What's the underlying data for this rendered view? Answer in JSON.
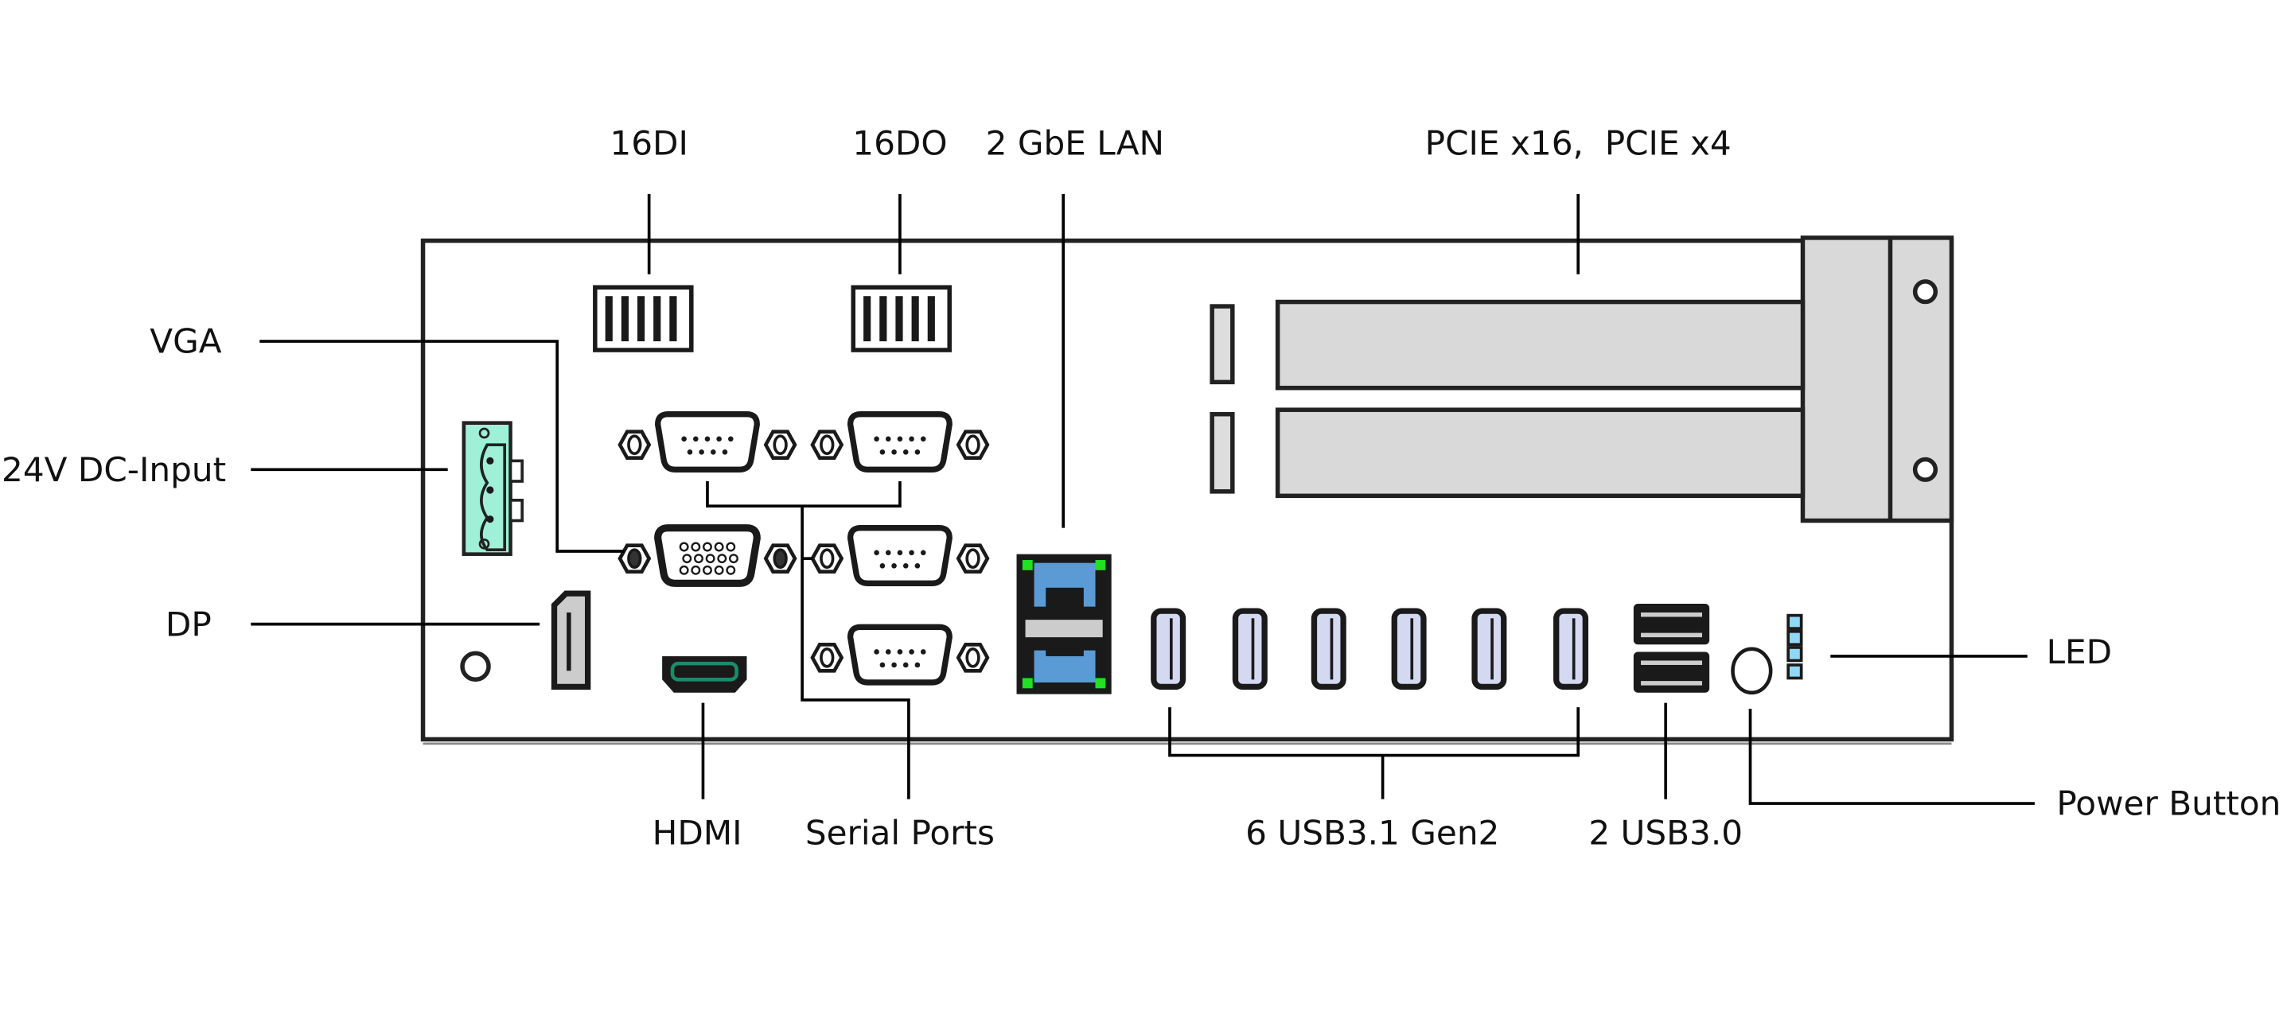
{
  "labels": {
    "di": "16DI",
    "do": "16DO",
    "lan": "2 GbE LAN",
    "pcie": "PCIE x16,  PCIE x4",
    "vga": "VGA",
    "dc": "24V DC-Input",
    "dp": "DP",
    "hdmi": "HDMI",
    "serial": "Serial Ports",
    "usb31": "6 USB3.1 Gen2",
    "usb30": "2 USB3.0",
    "led": "LED",
    "power": "Power Button"
  },
  "colors": {
    "dc_terminal": "#9ff0d6",
    "lan_port": "#5b9bd5",
    "lan_led": "#22e022",
    "hdmi_accent": "#1e8a6a",
    "usb_insert": "#d4d8f0",
    "led_indicator": "#8fd8f8",
    "pcie_slot": "#d9d9d9"
  },
  "counts": {
    "usb31_ports": 6,
    "usb30_ports": 2,
    "serial_ports": 4,
    "led_count": 4
  }
}
